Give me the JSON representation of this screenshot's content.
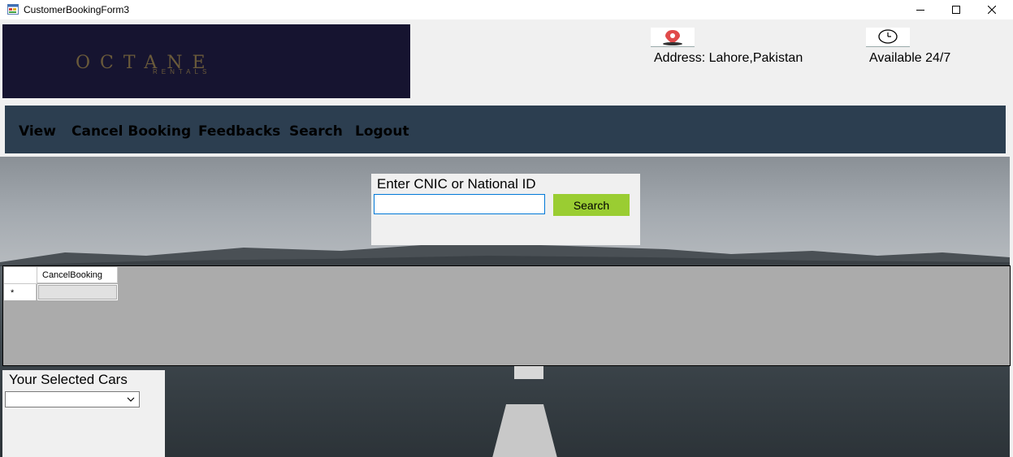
{
  "window": {
    "title": "CustomerBookingForm3",
    "controls": [
      "minimize",
      "maximize",
      "close"
    ]
  },
  "header": {
    "logo_text": "OCTANE",
    "logo_sub": "RENTALS",
    "address": "Address: Lahore,Pakistan",
    "availability": "Available 24/7",
    "icons": [
      "location-pin-icon",
      "clock-icon"
    ],
    "logo_bg": "#161430"
  },
  "nav": {
    "bg": "#2c3e50",
    "items": [
      {
        "label": "View"
      },
      {
        "label": "Cancel Booking"
      },
      {
        "label": "Feedbacks"
      },
      {
        "label": "Search"
      },
      {
        "label": "Logout"
      }
    ]
  },
  "search": {
    "label": "Enter CNIC or National ID",
    "input_value": "",
    "button_label": "Search",
    "button_color": "#9acd32"
  },
  "grid": {
    "columns": [
      "CancelBooking"
    ],
    "new_row_marker": "*"
  },
  "cars": {
    "label": "Your Selected Cars",
    "selected": ""
  }
}
